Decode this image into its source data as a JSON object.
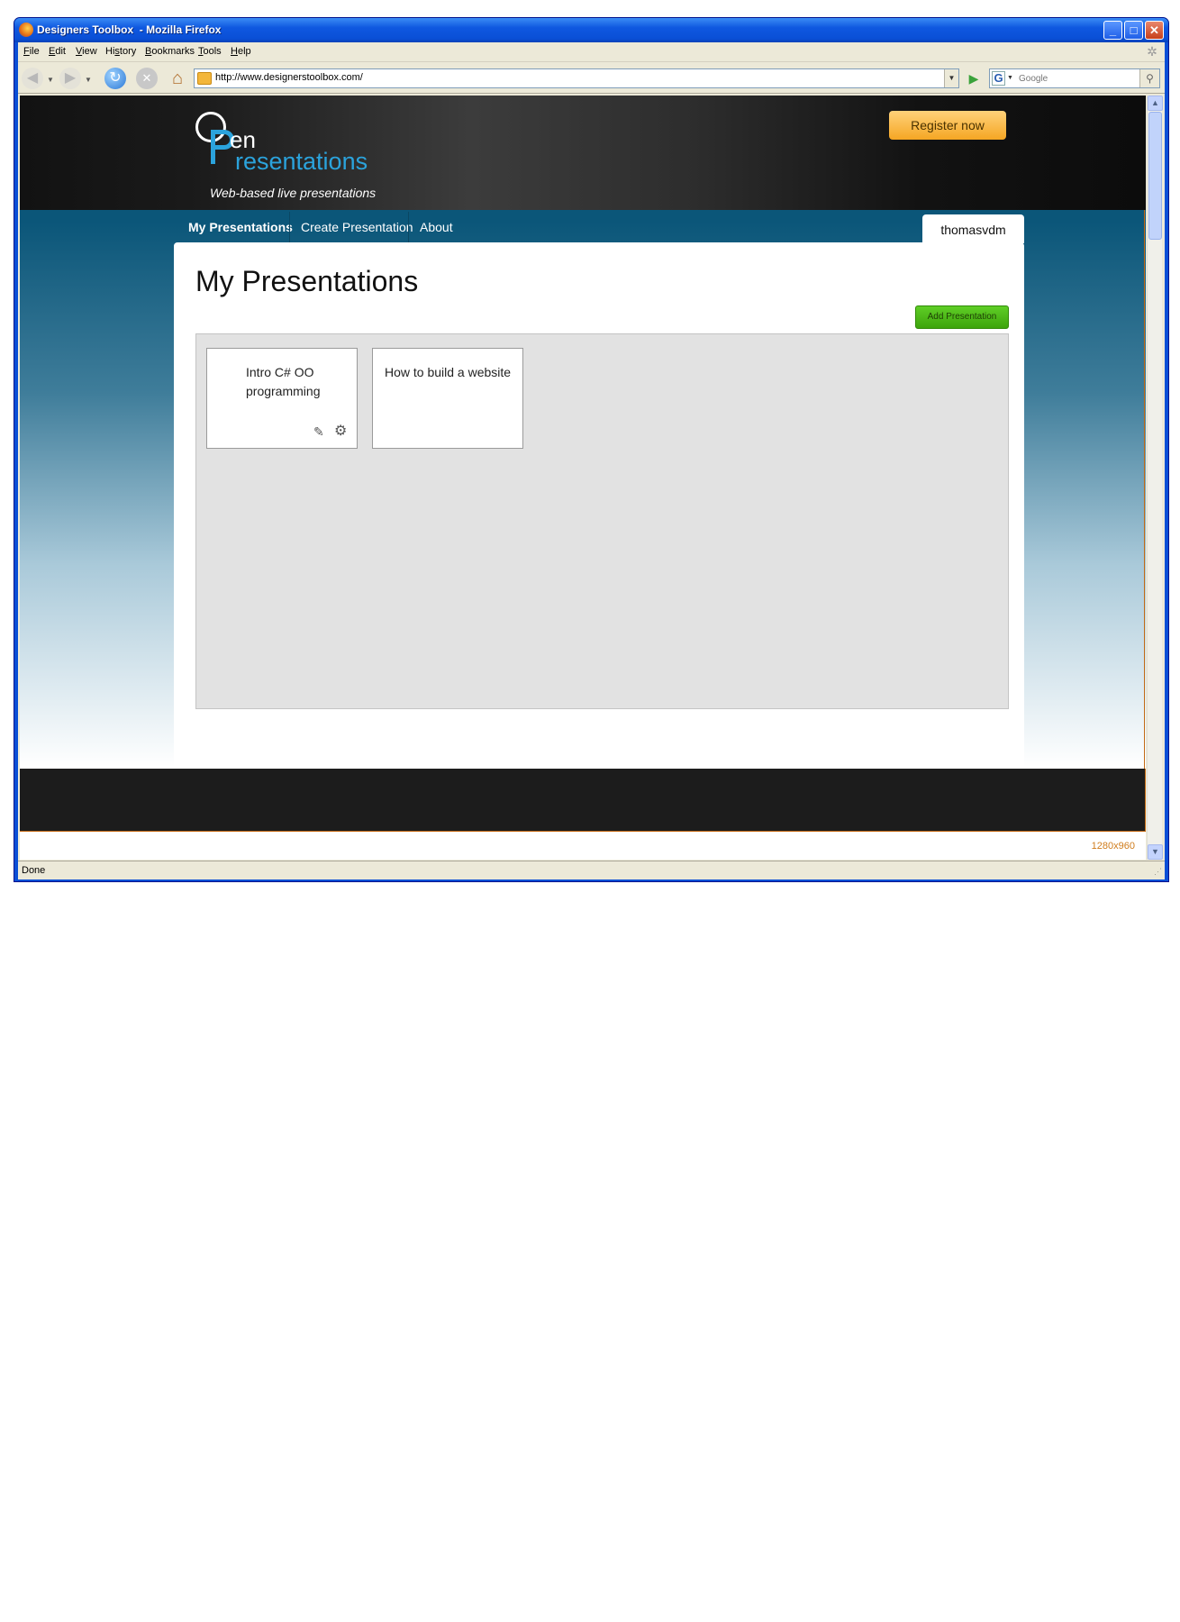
{
  "window": {
    "title": "Designers Toolbox  - Mozilla Firefox",
    "controls": {
      "minimize": "_",
      "maximize": "□",
      "close": "✕"
    }
  },
  "menu": [
    "File",
    "Edit",
    "View",
    "History",
    "Bookmarks",
    "Tools",
    "Help"
  ],
  "menu_access_keys": [
    "F",
    "E",
    "V",
    "s",
    "B",
    "T",
    "H"
  ],
  "toolbar": {
    "url": "http://www.designerstoolbox.com/",
    "search_placeholder": "Google",
    "search_engine_letter": "G",
    "icons": [
      "back-icon",
      "forward-icon",
      "reload-icon",
      "stop-icon",
      "home-icon",
      "go-icon",
      "search-icon"
    ]
  },
  "site": {
    "logo_o": "O",
    "logo_en": "en",
    "logo_resentations": "resentations",
    "tagline": "Web-based live presentations",
    "register_label": "Register now",
    "nav": [
      "My Presentations",
      "Create Presentation",
      "About"
    ],
    "active_nav": "My Presentations",
    "user": "thomasvdm"
  },
  "main": {
    "title": "My Presentations",
    "add_label": "Add Presentation",
    "presentations": [
      {
        "title": "Intro C# OO programming",
        "actions": [
          "edit-icon",
          "settings-icon"
        ]
      },
      {
        "title": "How to build a website"
      }
    ]
  },
  "overlay": {
    "resolution_label": "1280x960"
  },
  "status": {
    "text": "Done"
  },
  "colors": {
    "header_dark": "#1a1a1a",
    "nav_blue": "#0b5679",
    "logo_blue": "#2ba3dc",
    "register_orange": "#f5a623",
    "add_green": "#3da40c",
    "gallery_grey": "#e2e2e2",
    "resolution_orange": "#d07c1c"
  }
}
